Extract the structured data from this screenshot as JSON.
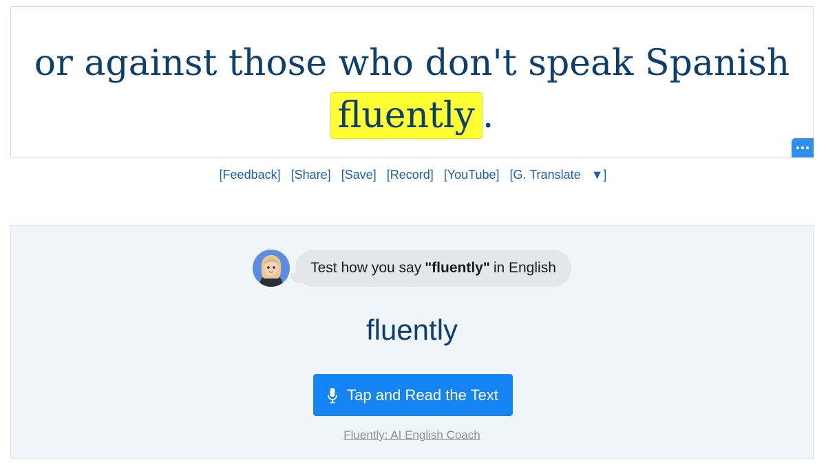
{
  "caption": {
    "line1": "or against those who don't speak Spanish",
    "highlight": "fluently",
    "trailing": "."
  },
  "links": {
    "feedback": "[Feedback]",
    "share": "[Share]",
    "save": "[Save]",
    "record": "[Record]",
    "youtube": "[YouTube]",
    "translate": "[G. Translate",
    "translate_arrow": "▼]"
  },
  "practice": {
    "prompt_prefix": "Test how you say",
    "prompt_word": "\"fluently\"",
    "prompt_suffix": "in English",
    "target_word": "fluently",
    "button_label": "Tap and Read the Text",
    "coach_link": "Fluently: AI English Coach"
  },
  "colors": {
    "highlight": "#ffff33",
    "button": "#1484f5",
    "caption_text": "#0d3f6e",
    "link": "#1e5fa8"
  },
  "icons": {
    "more": "ellipsis-icon",
    "mic": "microphone-icon",
    "avatar": "avatar-icon"
  }
}
